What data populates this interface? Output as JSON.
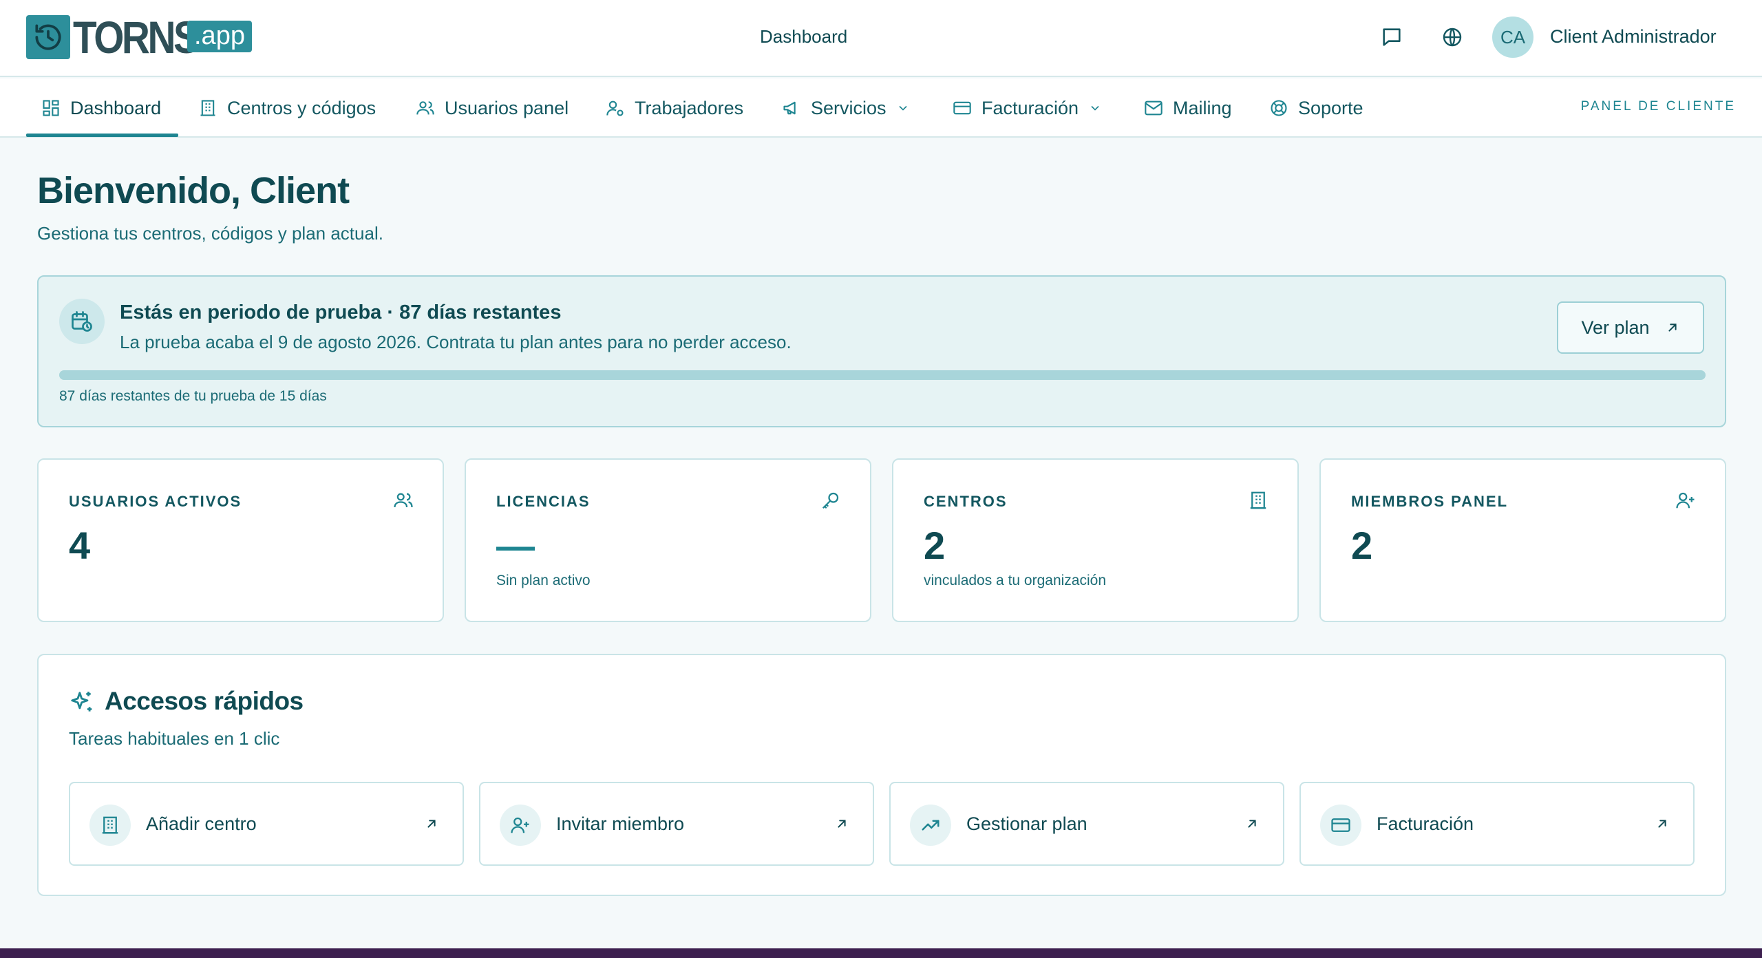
{
  "app": {
    "logo_text": "TORNS",
    "logo_suffix": ".app"
  },
  "header": {
    "title": "Dashboard",
    "user_initials": "CA",
    "user_name": "Client Administrador"
  },
  "nav": {
    "items": [
      {
        "label": "Dashboard",
        "icon": "grid-icon",
        "active": true
      },
      {
        "label": "Centros y códigos",
        "icon": "building-icon"
      },
      {
        "label": "Usuarios panel",
        "icon": "users-icon"
      },
      {
        "label": "Trabajadores",
        "icon": "user-gear-icon"
      },
      {
        "label": "Servicios",
        "icon": "megaphone-icon",
        "dropdown": true
      },
      {
        "label": "Facturación",
        "icon": "credit-card-icon",
        "dropdown": true
      },
      {
        "label": "Mailing",
        "icon": "mail-icon"
      },
      {
        "label": "Soporte",
        "icon": "lifebuoy-icon"
      }
    ],
    "panel_label": "PANEL DE CLIENTE"
  },
  "welcome": {
    "title": "Bienvenido, Client",
    "subtitle": "Gestiona tus centros, códigos y plan actual."
  },
  "trial": {
    "title": "Estás en periodo de prueba · 87 días restantes",
    "description": "La prueba acaba el 9 de agosto 2026. Contrata tu plan antes para no perder acceso.",
    "button_label": "Ver plan",
    "progress_fraction": 1.0,
    "footer": "87 días restantes de tu prueba de 15 días"
  },
  "stats": [
    {
      "label": "USUARIOS ACTIVOS",
      "value": "4",
      "note": "",
      "icon": "users-icon"
    },
    {
      "label": "LICENCIAS",
      "value": "—",
      "note": "Sin plan activo",
      "icon": "key-icon"
    },
    {
      "label": "CENTROS",
      "value": "2",
      "note": "vinculados a tu organización",
      "icon": "building-icon"
    },
    {
      "label": "MIEMBROS PANEL",
      "value": "2",
      "note": "",
      "icon": "user-plus-icon"
    }
  ],
  "quick": {
    "title": "Accesos rápidos",
    "subtitle": "Tareas habituales en 1 clic",
    "actions": [
      {
        "label": "Añadir centro",
        "icon": "building-icon"
      },
      {
        "label": "Invitar miembro",
        "icon": "user-plus-icon"
      },
      {
        "label": "Gestionar plan",
        "icon": "trending-up-icon"
      },
      {
        "label": "Facturación",
        "icon": "credit-card-icon"
      }
    ]
  },
  "colors": {
    "accent": "#1e8591",
    "text": "#0f4a52",
    "background": "#f4f9fa",
    "trial_bg": "#e6f3f4"
  }
}
